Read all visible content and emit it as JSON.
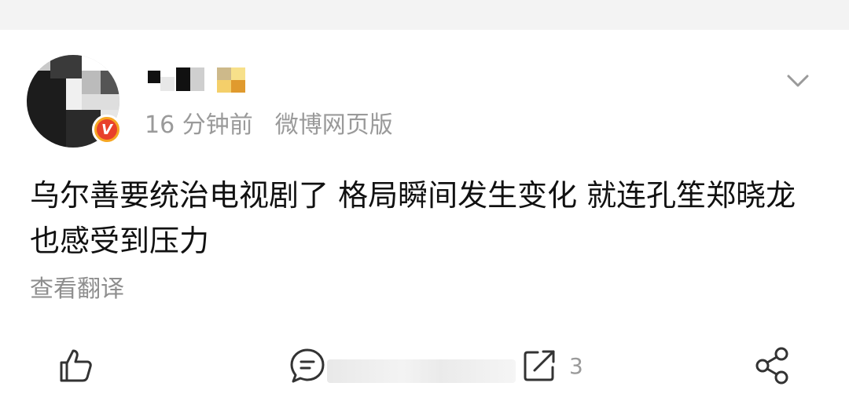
{
  "post": {
    "username": "",
    "time": "16 分钟前",
    "source": "微博网页版",
    "content": "乌尔善要统治电视剧了 格局瞬间发生变化 就连孔笙郑晓龙也感受到压力",
    "translate_label": "查看翻译",
    "verified_badge": "V"
  },
  "actions": {
    "like_icon": "thumbs-up-icon",
    "comment_icon": "comment-bubble-icon",
    "repost_icon": "repost-icon",
    "repost_count": "3",
    "share_icon": "share-icon",
    "more_icon": "chevron-down-icon"
  },
  "colors": {
    "text": "#111111",
    "meta": "#9a9a9a",
    "badge_outer": "#f6a623",
    "badge_inner": "#e8412b"
  }
}
